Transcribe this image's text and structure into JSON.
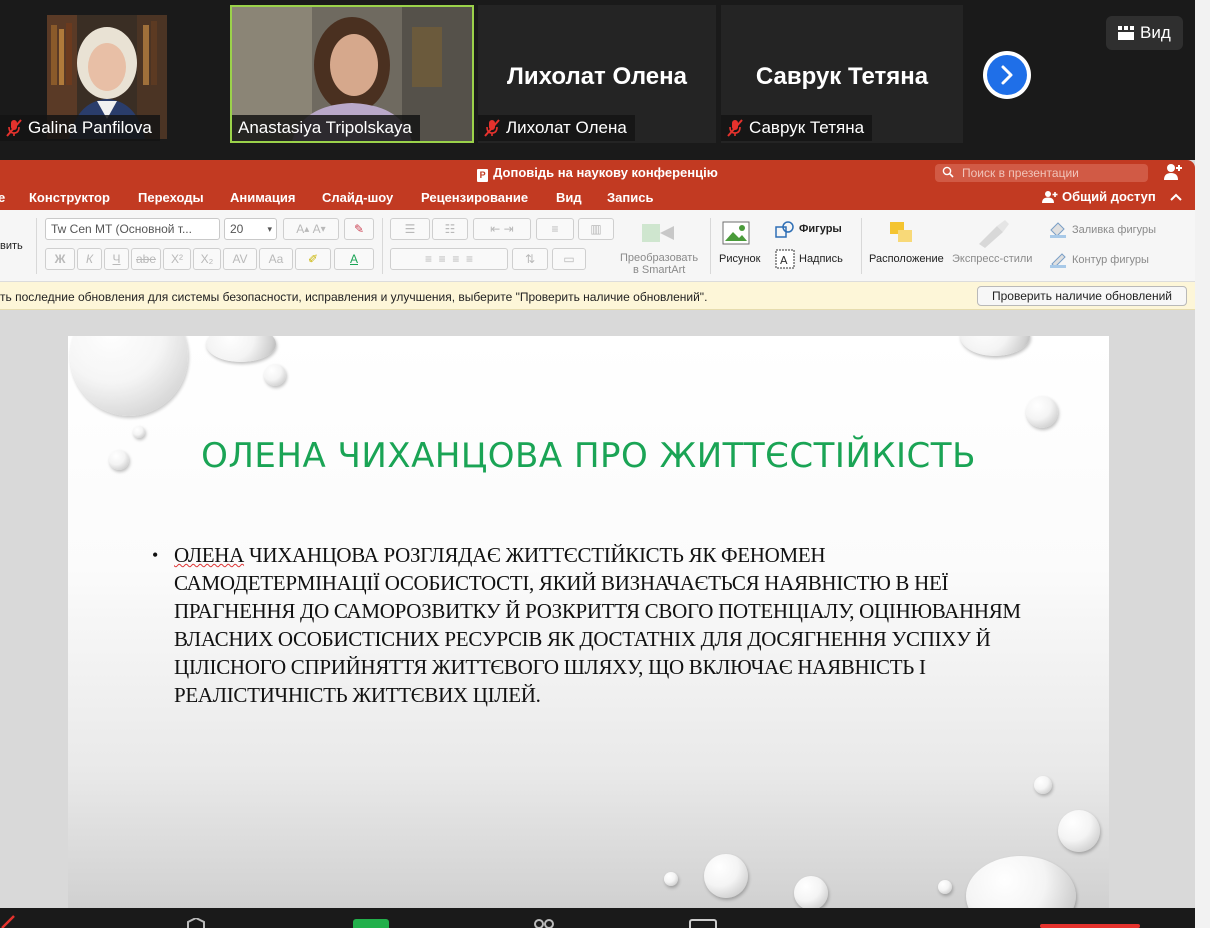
{
  "zoom": {
    "participants": [
      {
        "name": "Galina Panfilova",
        "muted": true,
        "video": true
      },
      {
        "name": "Anastasiya Tripolskaya",
        "muted": false,
        "video": true,
        "active_speaker": true
      },
      {
        "name": "Лихолат Олена",
        "display_name": "Лихолат Олена",
        "muted": true,
        "video": false
      },
      {
        "name": "Саврук Тетяна",
        "display_name": "Саврук Тетяна",
        "muted": true,
        "video": false
      }
    ],
    "view_label": "Вид",
    "next_icon": "chevron-right-icon",
    "colors": {
      "active_border": "#9bd24a",
      "next_button": "#1f6fe8",
      "muted_icon": "#e5322d"
    }
  },
  "powerpoint": {
    "doc_title": "Доповідь на наукову конференцію",
    "search_placeholder": "Поиск в презентации",
    "tabs": [
      "е",
      "Конструктор",
      "Переходы",
      "Анимация",
      "Слайд-шоу",
      "Рецензирование",
      "Вид",
      "Запись"
    ],
    "share_label": "Общий доступ",
    "ribbon": {
      "paste_partial": "вить",
      "font_name": "Tw Cen MT (Основной т...",
      "font_size": "20",
      "smartart_label_1": "Преобразовать",
      "smartart_label_2": "в SmartArt",
      "picture_label": "Рисунок",
      "shapes_label": "Фигуры",
      "textbox_label": "Надпись",
      "arrange_label": "Расположение",
      "quick_styles_label": "Экспресс-стили",
      "shape_fill_label": "Заливка фигуры",
      "shape_outline_label": "Контур фигуры"
    },
    "update_message": "ть последние обновления для системы безопасности, исправления и улучшения, выберите \"Проверить наличие обновлений\".",
    "update_button": "Проверить наличие обновлений",
    "colors": {
      "ribbon": "#c23a22",
      "update_bar": "#fdf6d8"
    }
  },
  "slide": {
    "title": "ОЛЕНА ЧИХАНЦОВА ПРО ЖИТТЄСТІЙКІСТЬ",
    "bullet_first_word": "ОЛЕНА",
    "bullet_rest": " ЧИХАНЦОВА РОЗГЛЯДАЄ ЖИТТЄСТІЙКІСТЬ ЯК ФЕНОМЕН САМОДЕТЕРМІНАЦІЇ ОСОБИСТОСТІ, ЯКИЙ ВИЗНАЧАЄТЬСЯ НАЯВНІСТЮ В НЕЇ ПРАГНЕННЯ ДО САМОРОЗВИТКУ Й РОЗКРИТТЯ СВОГО ПОТЕНЦІАЛУ, ОЦІНЮВАННЯМ ВЛАСНИХ ОСОБИСТІСНИХ РЕСУРСІВ ЯК ДОСТАТНІХ ДЛЯ ДОСЯГНЕННЯ УСПІХУ Й ЦІЛІСНОГО СПРИЙНЯТТЯ ЖИТТЄВОГО ШЛЯХУ, ЩО ВКЛЮЧАЄ НАЯВНІСТЬ І РЕАЛІСТИЧНІСТЬ ЖИТТЄВИХ ЦІЛЕЙ.",
    "title_color": "#1aa455"
  }
}
